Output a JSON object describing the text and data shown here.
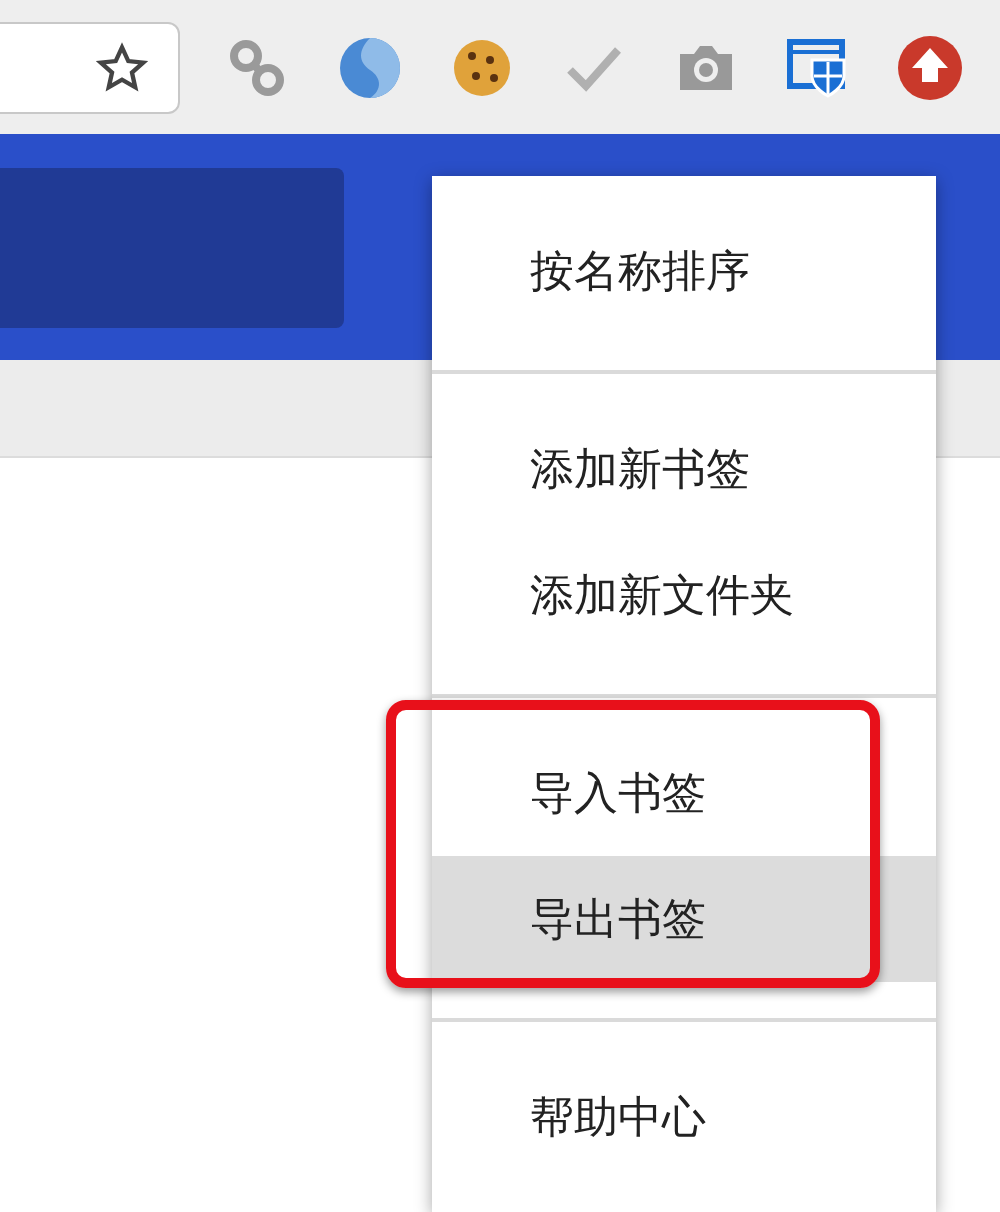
{
  "toolbar": {
    "extensions": [
      {
        "kind": "link"
      },
      {
        "kind": "s-logo"
      },
      {
        "kind": "cookie"
      },
      {
        "kind": "check"
      },
      {
        "kind": "camera"
      },
      {
        "kind": "shield"
      },
      {
        "kind": "upload"
      }
    ]
  },
  "menu": {
    "groups": [
      {
        "items": [
          {
            "label": "按名称排序",
            "selected": false,
            "annotated": false
          }
        ]
      },
      {
        "items": [
          {
            "label": "添加新书签",
            "selected": false,
            "annotated": false
          },
          {
            "label": "添加新文件夹",
            "selected": false,
            "annotated": false
          }
        ]
      },
      {
        "items": [
          {
            "label": "导入书签",
            "selected": false,
            "annotated": true
          },
          {
            "label": "导出书签",
            "selected": true,
            "annotated": true
          }
        ]
      },
      {
        "items": [
          {
            "label": "帮助中心",
            "selected": false,
            "annotated": false
          }
        ]
      }
    ]
  }
}
